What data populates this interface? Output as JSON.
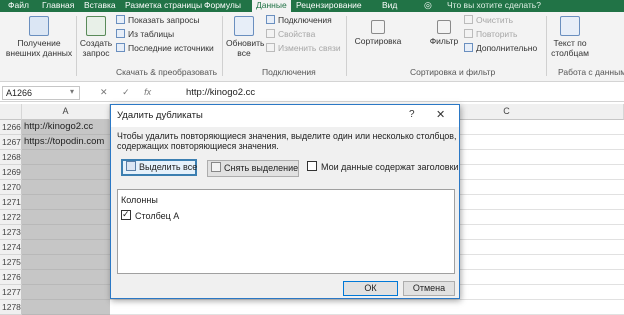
{
  "tabs": [
    "Файл",
    "Главная",
    "Вставка",
    "Разметка страницы",
    "Формулы",
    "Данные",
    "Рецензирование",
    "Вид"
  ],
  "tell_me": "Что вы хотите сделать?",
  "ribbon": {
    "get_external": [
      "Получение",
      "внешних данных"
    ],
    "create_query": [
      "Создать",
      "запрос"
    ],
    "show_queries": "Показать запросы",
    "from_table": "Из таблицы",
    "recent_sources": "Последние источники",
    "group_transform": "Скачать & преобразовать",
    "refresh_all": [
      "Обновить",
      "все"
    ],
    "connections": "Подключения",
    "properties": "Свойства",
    "edit_links": "Изменить связи",
    "group_connections": "Подключения",
    "sort": "Сортировка",
    "filter": "Фильтр",
    "clear": "Очистить",
    "reapply": "Повторить",
    "advanced": "Дополнительно",
    "group_sort": "Сортировка и фильтр",
    "text_to_cols": [
      "Текст по",
      "столбцам"
    ],
    "group_data_tools": "Работа с данными"
  },
  "formula_bar": {
    "name_box": "A1266",
    "fx": "fx",
    "formula": "http://kinogo2.cc"
  },
  "columns": [
    "A",
    "B",
    "C"
  ],
  "rows": [
    {
      "num": "1266",
      "a": "http://kinogo2.cc"
    },
    {
      "num": "1267",
      "a": "https://topodin.com"
    },
    {
      "num": "1268",
      "a": ""
    },
    {
      "num": "1269",
      "a": ""
    },
    {
      "num": "1270",
      "a": ""
    },
    {
      "num": "1271",
      "a": ""
    },
    {
      "num": "1272",
      "a": ""
    },
    {
      "num": "1273",
      "a": ""
    },
    {
      "num": "1274",
      "a": ""
    },
    {
      "num": "1275",
      "a": ""
    },
    {
      "num": "1276",
      "a": ""
    },
    {
      "num": "1277",
      "a": ""
    },
    {
      "num": "1278",
      "a": ""
    }
  ],
  "dialog": {
    "title": "Удалить дубликаты",
    "help": "?",
    "close": "✕",
    "message": "Чтобы удалить повторяющиеся значения, выделите один или несколько столбцов, содержащих повторяющиеся значения.",
    "select_all": "Выделить все",
    "unselect_all": "Снять выделение",
    "headers_label": "Мои данные содержат заголовки",
    "headers_checked": false,
    "list_header": "Колонны",
    "list_item": "Столбец A",
    "list_item_checked": true,
    "ok": "ОК",
    "cancel": "Отмена"
  }
}
